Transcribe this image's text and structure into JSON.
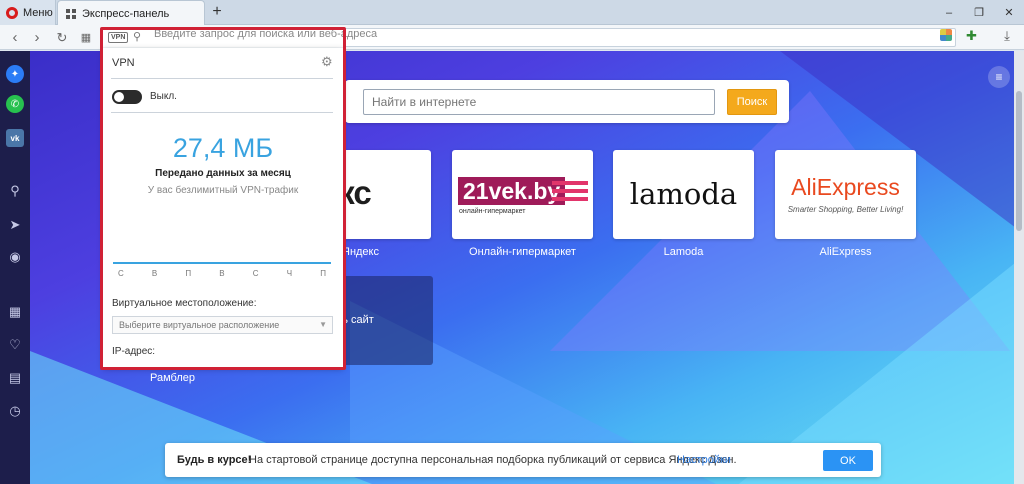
{
  "browser": {
    "menu_label": "Меню",
    "tab_title": "Экспресс-панель",
    "new_tab_label": "+",
    "address_placeholder": "Введите запрос для поиска или веб-адреса"
  },
  "vpn": {
    "badge": "VPN",
    "title": "VPN",
    "toggle_label": "Выкл.",
    "data_amount": "27,4 МБ",
    "data_label": "Передано данных за месяц",
    "traffic_note": "У вас безлимитный VPN-трафик",
    "weekdays": [
      "С",
      "В",
      "П",
      "В",
      "С",
      "Ч",
      "П"
    ],
    "location_label": "Виртуальное местоположение:",
    "location_placeholder": "Выберите виртуальное расположение",
    "ip_label": "IP-адрес:"
  },
  "speed_dial": {
    "search_placeholder": "Найти в интернете",
    "search_button": "Поиск",
    "tiles": [
      {
        "name": "yandex",
        "logo": "ндекс",
        "caption": "Яндекс"
      },
      {
        "name": "21vek",
        "logo": "21vek.by",
        "sub": "онлайн-гипермаркет",
        "caption": "Онлайн-гипермаркет"
      },
      {
        "name": "lamoda",
        "logo": "lamoda",
        "caption": "Lamoda"
      },
      {
        "name": "aliexpress",
        "logo": "AliExpress",
        "sub": "Smarter Shopping, Better Living!",
        "caption": "AliExpress"
      }
    ],
    "add_site_label": "бавить сайт",
    "rambler_caption": "Рамблер"
  },
  "notification": {
    "bold": "Будь в курсе!",
    "text": "На стартовой странице доступна персональная подборка публикаций от сервиса Яндекс Дзен.",
    "link": "Настройки",
    "ok": "OK"
  },
  "colors": {
    "accent_vpn": "#39a3e0",
    "highlight_frame": "#d02135",
    "search_button": "#f4a91c",
    "ok_button": "#2b93f4"
  }
}
